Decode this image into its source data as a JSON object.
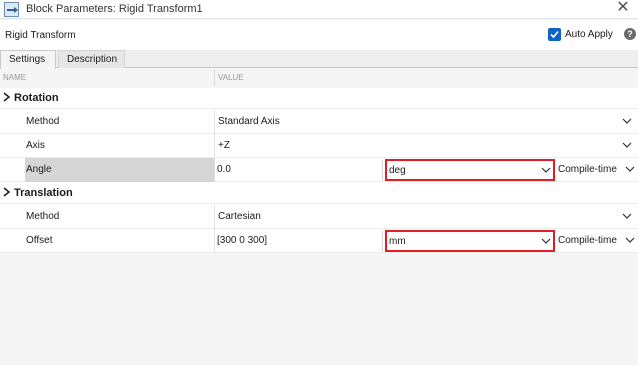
{
  "window": {
    "title": "Block Parameters: Rigid Transform1",
    "close_glyph": "✕"
  },
  "header": {
    "block_name": "Rigid Transform",
    "auto_apply_label": "Auto Apply",
    "auto_apply_checked": true,
    "help_glyph": "?"
  },
  "tabs": [
    {
      "label": "Settings",
      "active": true
    },
    {
      "label": "Description",
      "active": false
    }
  ],
  "columns": {
    "name": "NAME",
    "value": "VALUE"
  },
  "groups": {
    "rotation": {
      "label": "Rotation",
      "toggle": "❯",
      "method": {
        "label": "Method",
        "value": "Standard Axis"
      },
      "axis": {
        "label": "Axis",
        "value": "+Z"
      },
      "angle": {
        "label": "Angle",
        "value": "0.0",
        "unit": "deg",
        "config": "Compile-time"
      }
    },
    "translation": {
      "label": "Translation",
      "toggle": "❯",
      "method": {
        "label": "Method",
        "value": "Cartesian"
      },
      "offset": {
        "label": "Offset",
        "value": "[300 0 300]",
        "unit": "mm",
        "config": "Compile-time"
      }
    }
  },
  "colors": {
    "accent": "#0e63c4",
    "highlight_border": "#e01c24",
    "selected_row": "#d6d6d6"
  }
}
